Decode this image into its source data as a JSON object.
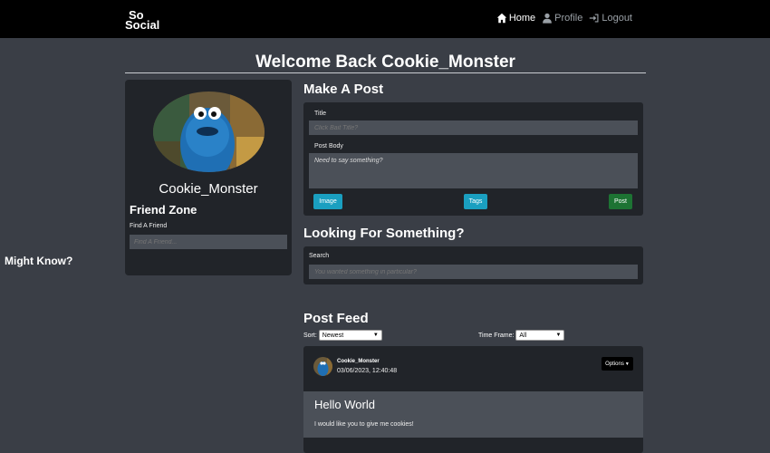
{
  "navbar": {
    "logo_line1": "So",
    "logo_line2": "Social",
    "home": "Home",
    "profile": "Profile",
    "logout": "Logout"
  },
  "welcome": "Welcome Back Cookie_Monster",
  "profile_card": {
    "username": "Cookie_Monster",
    "friend_zone": "Friend Zone",
    "find_label": "Find A Friend",
    "find_placeholder": "Find A Friend...",
    "might_know": "Might Know?"
  },
  "make_post": {
    "heading": "Make A Post",
    "title_label": "Title",
    "title_placeholder": "Click Bait Title?",
    "body_label": "Post Body",
    "body_placeholder": "Need to say something?",
    "image_button": "Image",
    "tags_button": "Tags",
    "post_button": "Post"
  },
  "search": {
    "heading": "Looking For Something?",
    "label": "Search",
    "placeholder": "You wanted something in particular?"
  },
  "feed": {
    "heading": "Post Feed",
    "sort_label": "Sort:",
    "sort_value": "Newest",
    "time_label": "Time Frame:",
    "time_value": "All",
    "post": {
      "author": "Cookie_Monster",
      "date": "03/06/2023, 12:40:48",
      "options": "Options",
      "title": "Hello World",
      "body": "I would like you to give me cookies!"
    }
  },
  "colors": {
    "page_bg": "#3a3e46",
    "card_bg": "#212429",
    "input_bg": "#4b5058",
    "info": "#1a9fc0",
    "success": "#1d7333"
  },
  "icons": [
    "house-icon",
    "user-icon",
    "logout-icon",
    "caret-down-icon"
  ]
}
